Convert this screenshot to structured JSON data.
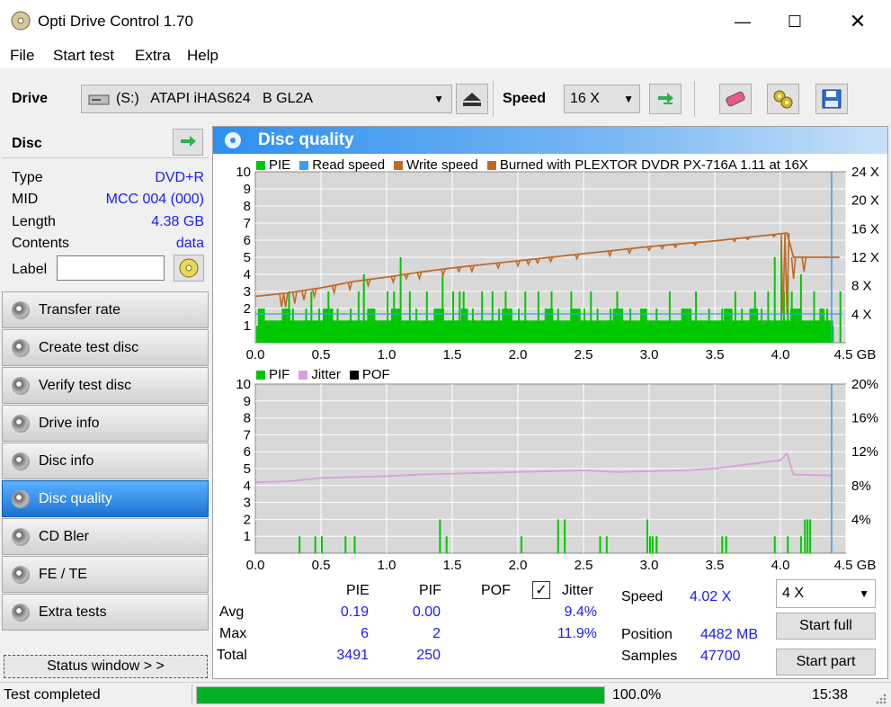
{
  "window": {
    "title": "Opti Drive Control 1.70"
  },
  "menu": [
    "File",
    "Start test",
    "Extra",
    "Help"
  ],
  "toolbar": {
    "drive_label": "Drive",
    "drive_value": "(S:)   ATAPI iHAS624   B GL2A",
    "speed_label": "Speed",
    "speed_value": "16 X"
  },
  "disc": {
    "header": "Disc",
    "type_label": "Type",
    "type_value": "DVD+R",
    "mid_label": "MID",
    "mid_value": "MCC 004 (000)",
    "length_label": "Length",
    "length_value": "4.38 GB",
    "contents_label": "Contents",
    "contents_value": "data",
    "label_label": "Label"
  },
  "nav": [
    {
      "label": "Transfer rate",
      "active": false
    },
    {
      "label": "Create test disc",
      "active": false
    },
    {
      "label": "Verify test disc",
      "active": false
    },
    {
      "label": "Drive info",
      "active": false
    },
    {
      "label": "Disc info",
      "active": false
    },
    {
      "label": "Disc quality",
      "active": true
    },
    {
      "label": "CD Bler",
      "active": false
    },
    {
      "label": "FE / TE",
      "active": false
    },
    {
      "label": "Extra tests",
      "active": false
    }
  ],
  "status_window": "Status window > >",
  "main": {
    "title": "Disc quality"
  },
  "chart1": {
    "legend": [
      {
        "label": "PIE",
        "color": "#00c800"
      },
      {
        "label": "Read speed",
        "color": "#3c9cf0"
      },
      {
        "label": "Write speed",
        "color": "#c06a28"
      },
      {
        "label": "Burned with PLEXTOR DVDR   PX-716A 1.11 at 16X",
        "color": "#c06a28"
      }
    ],
    "yleft": [
      "10",
      "9",
      "8",
      "7",
      "6",
      "5",
      "4",
      "3",
      "2",
      "1"
    ],
    "yright": [
      "24 X",
      "20 X",
      "16 X",
      "12 X",
      "8 X",
      "4 X"
    ],
    "x": [
      "0.0",
      "0.5",
      "1.0",
      "1.5",
      "2.0",
      "2.5",
      "3.0",
      "3.5",
      "4.0",
      "4.5 GB"
    ]
  },
  "chart2": {
    "legend": [
      {
        "label": "PIF",
        "color": "#00c800"
      },
      {
        "label": "Jitter",
        "color": "#d8a0d8"
      },
      {
        "label": "POF",
        "color": "#000000"
      }
    ],
    "yleft": [
      "10",
      "9",
      "8",
      "7",
      "6",
      "5",
      "4",
      "3",
      "2",
      "1"
    ],
    "yright": [
      "20%",
      "16%",
      "12%",
      "8%",
      "4%"
    ],
    "x": [
      "0.0",
      "0.5",
      "1.0",
      "1.5",
      "2.0",
      "2.5",
      "3.0",
      "3.5",
      "4.0",
      "4.5 GB"
    ]
  },
  "chart_data": [
    {
      "type": "bar",
      "title": "",
      "xlabel": "GB",
      "xlim": [
        0,
        4.5
      ],
      "ylim": [
        0,
        10
      ],
      "y2lim": [
        0,
        24
      ],
      "series": [
        {
          "name": "PIE",
          "style": "bar",
          "note_baseline": "dense ~1-2 across disc",
          "x": [
            0.22,
            0.25,
            0.28,
            0.38,
            0.42,
            0.48,
            0.55,
            0.62,
            0.72,
            0.78,
            0.82,
            0.9,
            1.0,
            1.05,
            1.1,
            1.17,
            1.22,
            1.3,
            1.38,
            1.42,
            1.5,
            1.55,
            1.58,
            1.65,
            1.72,
            1.8,
            1.85,
            1.9,
            2.0,
            2.05,
            2.15,
            2.25,
            2.3,
            2.4,
            2.5,
            2.55,
            2.6,
            2.7,
            2.75,
            2.85,
            2.95,
            3.05,
            3.15,
            3.25,
            3.35,
            3.45,
            3.55,
            3.6,
            3.65,
            3.7,
            3.8,
            3.85,
            3.9,
            3.95,
            4.0,
            4.02,
            4.05,
            4.08,
            4.15,
            4.25,
            4.35,
            4.45
          ],
          "y": [
            2,
            3,
            2,
            2,
            3,
            2,
            3,
            2,
            2,
            3,
            4,
            2,
            3,
            3,
            5,
            3,
            2,
            3,
            2,
            4,
            3,
            3,
            3,
            2,
            3,
            3,
            2,
            3,
            2,
            3,
            3,
            3,
            2,
            3,
            2,
            3,
            2,
            2,
            3,
            2,
            2,
            2,
            3,
            2,
            3,
            2,
            2,
            2,
            3,
            2,
            3,
            2,
            3,
            5,
            6,
            3,
            4,
            3,
            4,
            3,
            2,
            3
          ]
        },
        {
          "name": "Write speed",
          "style": "line",
          "axis": "right",
          "x": [
            0,
            0.25,
            0.5,
            0.75,
            1.0,
            1.25,
            1.5,
            1.75,
            2.0,
            2.25,
            2.5,
            2.75,
            3.0,
            3.25,
            3.5,
            3.75,
            4.0,
            4.05,
            4.1,
            4.3,
            4.45
          ],
          "y": [
            6.5,
            7.0,
            7.7,
            8.6,
            9.2,
            9.9,
            10.5,
            11.0,
            11.5,
            12.0,
            12.5,
            13.0,
            13.5,
            13.9,
            14.3,
            14.8,
            15.3,
            15.4,
            12.0,
            12.0,
            12.0
          ]
        },
        {
          "name": "Write speed dips",
          "style": "dips",
          "axis": "right",
          "x": [
            0.2,
            0.23,
            0.3,
            0.37,
            0.45,
            0.6,
            0.72,
            0.86,
            1.05,
            1.15,
            1.25,
            1.43,
            1.55,
            1.65,
            1.85,
            2.0,
            2.08,
            2.15,
            2.25,
            2.45,
            2.7,
            2.85,
            3.0,
            3.1,
            3.2,
            3.35,
            3.65,
            3.75,
            3.95,
            4.02,
            4.05,
            4.1,
            4.18
          ],
          "y": [
            5,
            5,
            5.5,
            6,
            6.5,
            7,
            7.5,
            8,
            8.5,
            9,
            9,
            9.5,
            10,
            10,
            10.5,
            10.8,
            11,
            11.2,
            11.4,
            11.8,
            12.2,
            12.6,
            13,
            13.2,
            13.4,
            13.7,
            14.2,
            14.5,
            14.9,
            4,
            4,
            9,
            10
          ]
        }
      ]
    },
    {
      "type": "bar",
      "title": "",
      "xlabel": "GB",
      "xlim": [
        0,
        4.5
      ],
      "ylim": [
        0,
        10
      ],
      "y2lim": [
        0,
        20
      ],
      "series": [
        {
          "name": "PIF",
          "style": "bar",
          "x": [
            0.33,
            0.45,
            0.5,
            0.68,
            0.75,
            1.4,
            1.45,
            2.02,
            2.3,
            2.35,
            2.62,
            2.67,
            2.98,
            3.0,
            3.02,
            3.05,
            3.05,
            3.55,
            3.58,
            3.95,
            4.05,
            4.15,
            4.18,
            4.2,
            4.22
          ],
          "y": [
            1,
            1,
            1,
            1,
            1,
            2,
            1,
            1,
            2,
            2,
            1,
            1,
            2,
            1,
            1,
            1,
            1,
            1,
            1,
            1,
            1,
            1,
            2,
            2,
            2
          ]
        },
        {
          "name": "Jitter",
          "style": "line",
          "axis": "right",
          "x": [
            0,
            0.25,
            0.5,
            0.75,
            1.0,
            1.25,
            1.5,
            1.75,
            2.0,
            2.25,
            2.5,
            2.75,
            3.0,
            3.25,
            3.5,
            3.75,
            4.0,
            4.05,
            4.1,
            4.4
          ],
          "y": [
            8.4,
            8.5,
            8.9,
            9.0,
            9.1,
            9.3,
            9.4,
            9.5,
            9.6,
            9.7,
            9.8,
            9.6,
            9.7,
            9.8,
            10.0,
            10.5,
            11.0,
            11.8,
            9.3,
            9.2
          ]
        }
      ]
    }
  ],
  "stats": {
    "col_pie": "PIE",
    "col_pif": "PIF",
    "col_pof": "POF",
    "col_jitter": "Jitter",
    "row_avg": "Avg",
    "row_max": "Max",
    "row_total": "Total",
    "avg_pie": "0.19",
    "avg_pif": "0.00",
    "avg_jitter": "9.4%",
    "max_pie": "6",
    "max_pif": "2",
    "max_jitter": "11.9%",
    "total_pie": "3491",
    "total_pif": "250"
  },
  "info": {
    "speed_label": "Speed",
    "speed_value": "4.02 X",
    "position_label": "Position",
    "position_value": "4482 MB",
    "samples_label": "Samples",
    "samples_value": "47700",
    "test_speed": "4 X",
    "start_full": "Start full",
    "start_part": "Start part"
  },
  "statusbar": {
    "text": "Test completed",
    "progress": "100.0%",
    "progress_fraction": 1.0,
    "time": "15:38"
  }
}
